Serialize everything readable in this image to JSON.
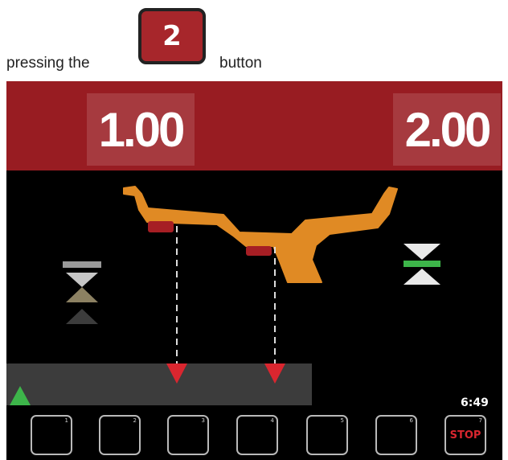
{
  "intro": {
    "text_before": "pressing the",
    "key_label": "2",
    "text_after": "button"
  },
  "screen": {
    "left_value": "1.00",
    "right_value": "2.00",
    "time": "6:49",
    "function_keys": [
      {
        "number": "1",
        "label": ""
      },
      {
        "number": "2",
        "label": ""
      },
      {
        "number": "3",
        "label": ""
      },
      {
        "number": "4",
        "label": ""
      },
      {
        "number": "5",
        "label": ""
      },
      {
        "number": "6",
        "label": ""
      },
      {
        "number": "7",
        "label": "STOP"
      }
    ]
  },
  "colors": {
    "header_red": "#981c22",
    "wheel_orange": "#e08a24",
    "marker_red": "#d9262f",
    "indicator_green": "#3db54a"
  }
}
